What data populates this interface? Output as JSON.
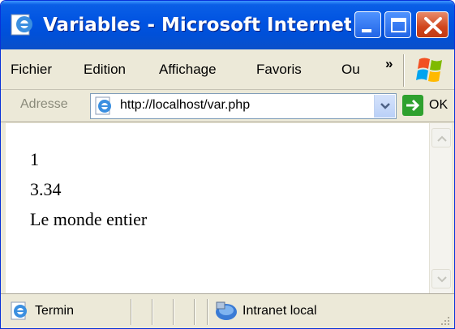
{
  "window": {
    "title": "Variables - Microsoft Internet..."
  },
  "menu": {
    "items": [
      "Fichier",
      "Edition",
      "Affichage",
      "Favoris",
      "Ou"
    ],
    "overflow": "»"
  },
  "address": {
    "label": "Adresse",
    "url": "http://localhost/var.php",
    "go_label": "OK"
  },
  "content": {
    "lines": [
      "1",
      "3.34",
      "Le monde entier"
    ]
  },
  "status": {
    "text": "Termin",
    "zone": "Intranet local"
  },
  "colors": {
    "titlebar": "#0053e1",
    "close_button": "#d0451c",
    "chrome": "#ece9d8",
    "go_arrow": "#2ea12e"
  },
  "icons": [
    "ie-icon",
    "minimize-icon",
    "maximize-icon",
    "close-icon",
    "windows-logo-icon",
    "page-icon",
    "dropdown-arrow-icon",
    "go-arrow-icon",
    "scroll-up-icon",
    "scroll-down-icon",
    "network-zone-icon",
    "resize-grip-icon"
  ]
}
